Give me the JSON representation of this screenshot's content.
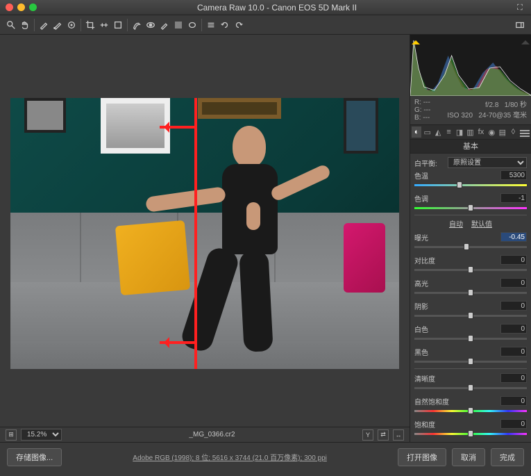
{
  "window": {
    "title": "Camera Raw 10.0  -  Canon EOS 5D Mark II"
  },
  "info": {
    "r": "R:   ---",
    "g": "G:   ---",
    "b": "B:   ---",
    "aperture": "f/2.8",
    "shutter": "1/80 秒",
    "iso": "ISO 320",
    "lens": "24-70@35 毫米"
  },
  "panel": {
    "title": "基本",
    "wb_label": "白平衡:",
    "wb_value": "原照设置",
    "temp_label": "色温",
    "temp_value": "5300",
    "tint_label": "色调",
    "tint_value": "-1",
    "auto": "自动",
    "default": "默认值",
    "exposure_label": "曝光",
    "exposure_value": "-0.45",
    "contrast_label": "对比度",
    "contrast_value": "0",
    "highlights_label": "高光",
    "highlights_value": "0",
    "shadows_label": "阴影",
    "shadows_value": "0",
    "whites_label": "白色",
    "whites_value": "0",
    "blacks_label": "黑色",
    "blacks_value": "0",
    "clarity_label": "清晰度",
    "clarity_value": "0",
    "vibrance_label": "自然饱和度",
    "vibrance_value": "0",
    "saturation_label": "饱和度",
    "saturation_value": "0"
  },
  "footer": {
    "zoom": "15.2%",
    "filename": "_MG_0366.cr2",
    "y_btn": "Y"
  },
  "bottom": {
    "save": "存储图像...",
    "metadata": "Adobe RGB (1998);  8 位;  5616 x 3744 (21.0 百万像素);  300 ppi",
    "open": "打开图像",
    "cancel": "取消",
    "done": "完成"
  }
}
